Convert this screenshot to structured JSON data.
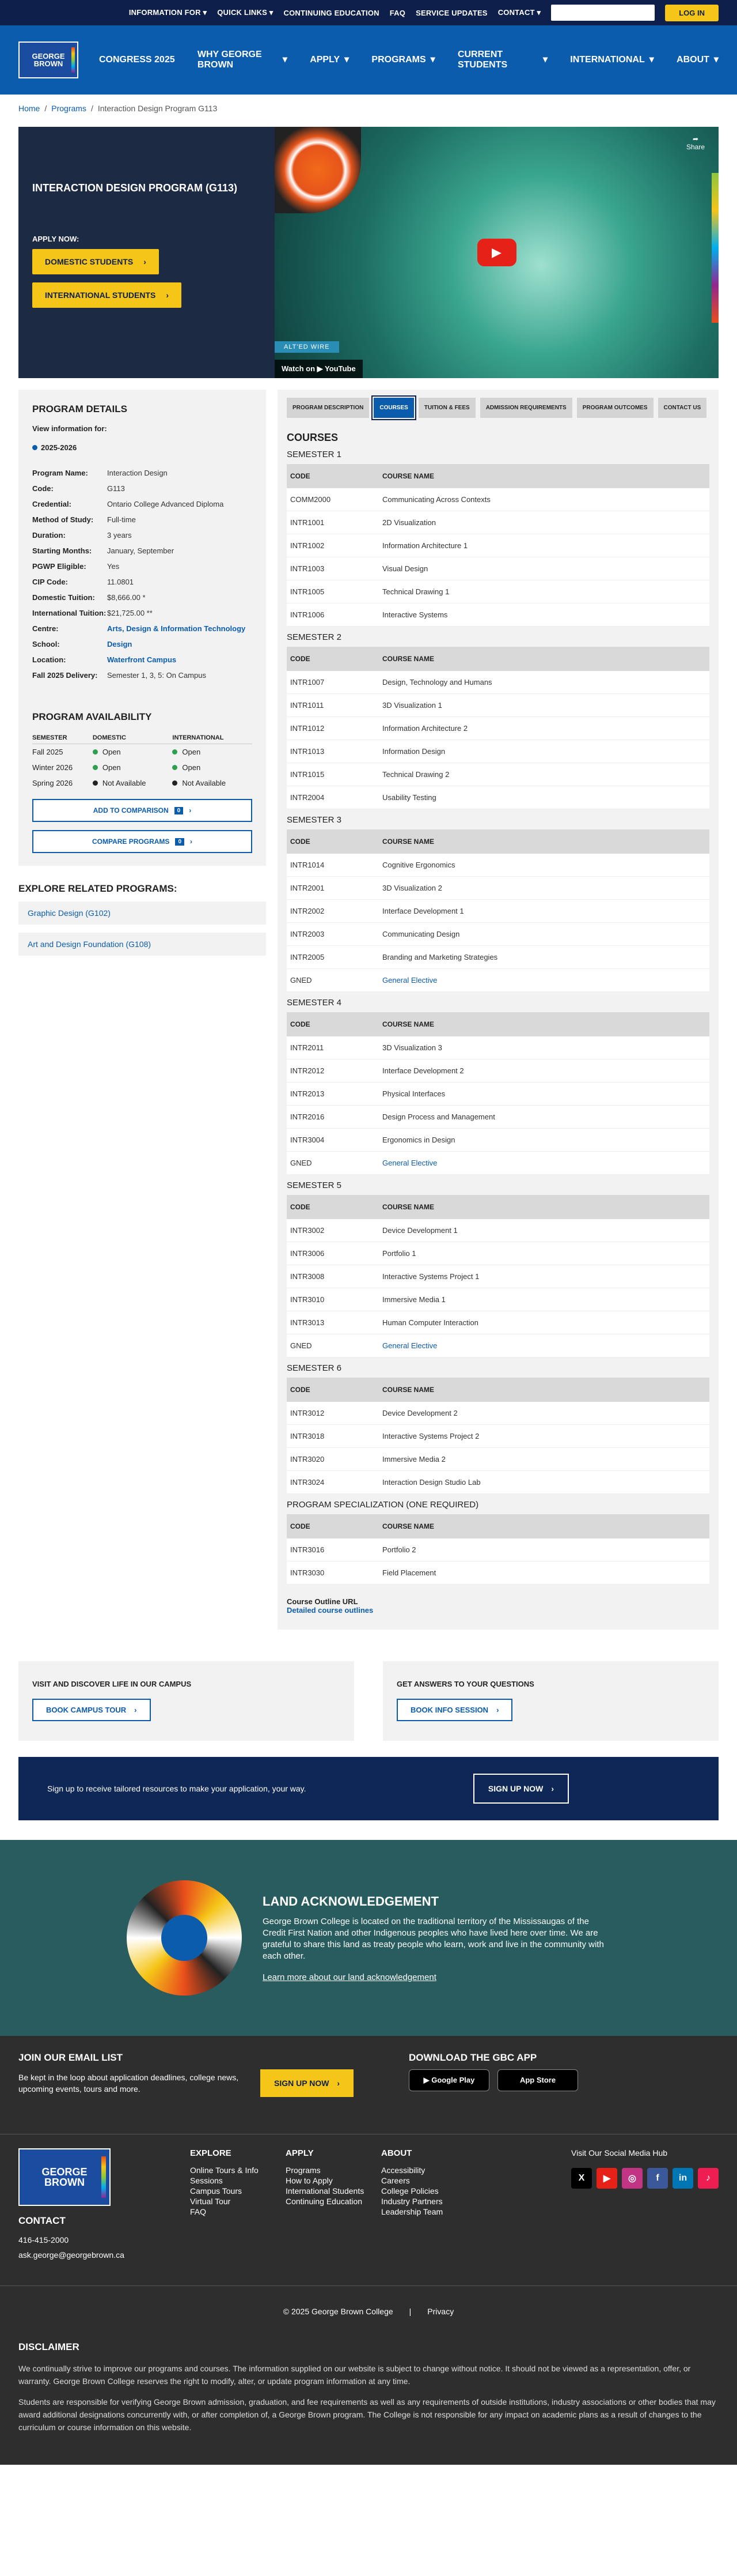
{
  "topbar": {
    "items": [
      "INFORMATION FOR",
      "QUICK LINKS",
      "CONTINUING EDUCATION",
      "FAQ",
      "SERVICE UPDATES",
      "CONTACT"
    ],
    "login": "LOG IN"
  },
  "logo": {
    "line1": "GEORGE",
    "line2": "BROWN"
  },
  "nav": {
    "items": [
      {
        "label": "CONGRESS 2025",
        "dropdown": false
      },
      {
        "label": "WHY GEORGE BROWN",
        "dropdown": true
      },
      {
        "label": "APPLY",
        "dropdown": true
      },
      {
        "label": "PROGRAMS",
        "dropdown": true
      },
      {
        "label": "CURRENT STUDENTS",
        "dropdown": true
      },
      {
        "label": "INTERNATIONAL",
        "dropdown": true
      },
      {
        "label": "ABOUT",
        "dropdown": true
      }
    ]
  },
  "breadcrumb": {
    "home": "Home",
    "programs": "Programs",
    "current": "Interaction Design Program G113",
    "sep": "/"
  },
  "hero": {
    "title": "INTERACTION DESIGN PROGRAM (G113)",
    "apply_label": "APPLY NOW:",
    "domestic": "DOMESTIC STUDENTS",
    "international": "INTERNATIONAL STUDENTS",
    "video_tag": "ALT'ED WIRE",
    "watch_on": "Watch on",
    "youtube": "YouTube",
    "share": "Share"
  },
  "details": {
    "heading": "PROGRAM DETAILS",
    "view_info": "View information for:",
    "year": "2025-2026",
    "rows": [
      {
        "k": "Program Name:",
        "v": "Interaction Design",
        "link": false
      },
      {
        "k": "Code:",
        "v": "G113",
        "link": false
      },
      {
        "k": "Credential:",
        "v": "Ontario College Advanced Diploma",
        "link": false
      },
      {
        "k": "Method of Study:",
        "v": "Full-time",
        "link": false
      },
      {
        "k": "Duration:",
        "v": "3 years",
        "link": false
      },
      {
        "k": "Starting Months:",
        "v": "January, September",
        "link": false
      },
      {
        "k": "PGWP Eligible:",
        "v": "Yes",
        "link": false
      },
      {
        "k": "CIP Code:",
        "v": "11.0801",
        "link": false
      },
      {
        "k": "Domestic Tuition:",
        "v": "$8,666.00 *",
        "link": false
      },
      {
        "k": "International Tuition:",
        "v": "$21,725.00 **",
        "link": false
      },
      {
        "k": "Centre:",
        "v": "Arts, Design & Information Technology",
        "link": true
      },
      {
        "k": "School:",
        "v": "Design",
        "link": true
      },
      {
        "k": "Location:",
        "v": "Waterfront Campus",
        "link": true
      },
      {
        "k": "Fall 2025 Delivery:",
        "v": "Semester 1, 3, 5: On Campus",
        "link": false
      }
    ]
  },
  "availability": {
    "heading": "PROGRAM AVAILABILITY",
    "cols": [
      "SEMESTER",
      "DOMESTIC",
      "INTERNATIONAL"
    ],
    "rows": [
      {
        "sem": "Fall 2025",
        "dom": "Open",
        "intl": "Open",
        "dom_color": "#2e9e4f",
        "intl_color": "#2e9e4f"
      },
      {
        "sem": "Winter 2026",
        "dom": "Open",
        "intl": "Open",
        "dom_color": "#2e9e4f",
        "intl_color": "#2e9e4f"
      },
      {
        "sem": "Spring 2026",
        "dom": "Not Available",
        "intl": "Not Available",
        "dom_color": "#222222",
        "intl_color": "#222222"
      }
    ],
    "add_comparison": "ADD TO COMPARISON",
    "compare": "COMPARE PROGRAMS",
    "add_count": "0",
    "compare_count": "0"
  },
  "related": {
    "heading": "EXPLORE RELATED PROGRAMS:",
    "items": [
      "Graphic Design (G102)",
      "Art and Design Foundation (G108)"
    ]
  },
  "tabs": [
    "PROGRAM DESCRIPTION",
    "COURSES",
    "TUITION & FEES",
    "ADMISSION REQUIREMENTS",
    "PROGRAM OUTCOMES",
    "CONTACT US"
  ],
  "courses": {
    "heading": "COURSES",
    "col_code": "CODE",
    "col_name": "COURSE NAME",
    "semesters": [
      {
        "title": "SEMESTER 1",
        "rows": [
          {
            "code": "COMM2000",
            "name": "Communicating Across Contexts",
            "link": false
          },
          {
            "code": "INTR1001",
            "name": "2D Visualization",
            "link": false
          },
          {
            "code": "INTR1002",
            "name": "Information Architecture 1",
            "link": false
          },
          {
            "code": "INTR1003",
            "name": "Visual Design",
            "link": false
          },
          {
            "code": "INTR1005",
            "name": "Technical Drawing 1",
            "link": false
          },
          {
            "code": "INTR1006",
            "name": "Interactive Systems",
            "link": false
          }
        ]
      },
      {
        "title": "SEMESTER 2",
        "rows": [
          {
            "code": "INTR1007",
            "name": "Design, Technology and Humans",
            "link": false
          },
          {
            "code": "INTR1011",
            "name": "3D Visualization 1",
            "link": false
          },
          {
            "code": "INTR1012",
            "name": "Information Architecture 2",
            "link": false
          },
          {
            "code": "INTR1013",
            "name": "Information Design",
            "link": false
          },
          {
            "code": "INTR1015",
            "name": "Technical Drawing 2",
            "link": false
          },
          {
            "code": "INTR2004",
            "name": "Usability Testing",
            "link": false
          }
        ]
      },
      {
        "title": "SEMESTER 3",
        "rows": [
          {
            "code": "INTR1014",
            "name": "Cognitive Ergonomics",
            "link": false
          },
          {
            "code": "INTR2001",
            "name": "3D Visualization 2",
            "link": false
          },
          {
            "code": "INTR2002",
            "name": "Interface Development 1",
            "link": false
          },
          {
            "code": "INTR2003",
            "name": "Communicating Design",
            "link": false
          },
          {
            "code": "INTR2005",
            "name": "Branding and Marketing Strategies",
            "link": false
          },
          {
            "code": "GNED",
            "name": "General Elective",
            "link": true
          }
        ]
      },
      {
        "title": "SEMESTER 4",
        "rows": [
          {
            "code": "INTR2011",
            "name": "3D Visualization 3",
            "link": false
          },
          {
            "code": "INTR2012",
            "name": "Interface Development 2",
            "link": false
          },
          {
            "code": "INTR2013",
            "name": "Physical Interfaces",
            "link": false
          },
          {
            "code": "INTR2016",
            "name": "Design Process and Management",
            "link": false
          },
          {
            "code": "INTR3004",
            "name": "Ergonomics in Design",
            "link": false
          },
          {
            "code": "GNED",
            "name": "General Elective",
            "link": true
          }
        ]
      },
      {
        "title": "SEMESTER 5",
        "rows": [
          {
            "code": "INTR3002",
            "name": "Device Development 1",
            "link": false
          },
          {
            "code": "INTR3006",
            "name": "Portfolio 1",
            "link": false
          },
          {
            "code": "INTR3008",
            "name": "Interactive Systems Project 1",
            "link": false
          },
          {
            "code": "INTR3010",
            "name": "Immersive Media 1",
            "link": false
          },
          {
            "code": "INTR3013",
            "name": "Human Computer Interaction",
            "link": false
          },
          {
            "code": "GNED",
            "name": "General Elective",
            "link": true
          }
        ]
      },
      {
        "title": "SEMESTER 6",
        "rows": [
          {
            "code": "INTR3012",
            "name": "Device Development 2",
            "link": false
          },
          {
            "code": "INTR3018",
            "name": "Interactive Systems Project 2",
            "link": false
          },
          {
            "code": "INTR3020",
            "name": "Immersive Media 2",
            "link": false
          },
          {
            "code": "INTR3024",
            "name": "Interaction Design Studio Lab",
            "link": false
          }
        ]
      },
      {
        "title": "PROGRAM SPECIALIZATION (ONE REQUIRED)",
        "rows": [
          {
            "code": "INTR3016",
            "name": "Portfolio 2",
            "link": false
          },
          {
            "code": "INTR3030",
            "name": "Field Placement",
            "link": false
          }
        ]
      }
    ],
    "outline_label": "Course Outline URL",
    "outline_link": "Detailed course outlines"
  },
  "cta": {
    "campus_heading": "VISIT AND DISCOVER LIFE IN OUR CAMPUS",
    "campus_btn": "BOOK CAMPUS TOUR",
    "info_heading": "GET ANSWERS TO YOUR QUESTIONS",
    "info_btn": "BOOK INFO SESSION"
  },
  "signup": {
    "text": "Sign up to receive tailored resources to make your application, your way.",
    "btn": "SIGN UP NOW"
  },
  "land": {
    "heading": "LAND ACKNOWLEDGEMENT",
    "text": "George Brown College is located on the traditional territory of the Mississaugas of the Credit First Nation and other Indigenous peoples who have lived here over time. We are grateful to share this land as treaty people who learn, work and live in the community with each other.",
    "link": "Learn more about our land acknowledgement"
  },
  "email": {
    "heading": "JOIN OUR EMAIL LIST",
    "text": "Be kept in the loop about application deadlines, college news, upcoming events, tours and more.",
    "btn": "SIGN UP NOW",
    "app_heading": "DOWNLOAD THE GBC APP",
    "google": "Google Play",
    "apple": "App Store"
  },
  "footer": {
    "contact_heading": "CONTACT",
    "phone": "416-415-2000",
    "email": "ask.george@georgebrown.ca",
    "cols": [
      {
        "title": "EXPLORE",
        "items": [
          "Online Tours & Info Sessions",
          "Campus Tours",
          "Virtual Tour",
          "FAQ"
        ]
      },
      {
        "title": "APPLY",
        "items": [
          "Programs",
          "How to Apply",
          "International Students",
          "Continuing Education"
        ]
      },
      {
        "title": "ABOUT",
        "items": [
          "Accessibility",
          "Careers",
          "College Policies",
          "Industry Partners",
          "Leadership Team"
        ]
      }
    ],
    "social_heading": "Visit Our Social Media Hub",
    "social": [
      {
        "name": "x-icon",
        "glyph": "X",
        "color": "#000000"
      },
      {
        "name": "youtube-icon",
        "glyph": "▶",
        "color": "#e62117"
      },
      {
        "name": "instagram-icon",
        "glyph": "◎",
        "color": "#c13584"
      },
      {
        "name": "facebook-icon",
        "glyph": "f",
        "color": "#3b5998"
      },
      {
        "name": "linkedin-icon",
        "glyph": "in",
        "color": "#0077b5"
      },
      {
        "name": "tiktok-icon",
        "glyph": "♪",
        "color": "#ee1d52"
      }
    ]
  },
  "bottom": {
    "copyright": "© 2025 George Brown College",
    "privacy": "Privacy",
    "disclaimer_heading": "DISCLAIMER",
    "p1": "We continually strive to improve our programs and courses. The information supplied on our website is subject to change without notice. It should not be viewed as a representation, offer, or warranty. George Brown College reserves the right to modify, alter, or update program information at any time.",
    "p2": "Students are responsible for verifying George Brown admission, graduation, and fee requirements as well as any requirements of outside institutions, industry associations or other bodies that may award additional designations concurrently with, or after completion of, a George Brown program. The College is not responsible for any impact on academic plans as a result of changes to the curriculum or course information on this website."
  }
}
